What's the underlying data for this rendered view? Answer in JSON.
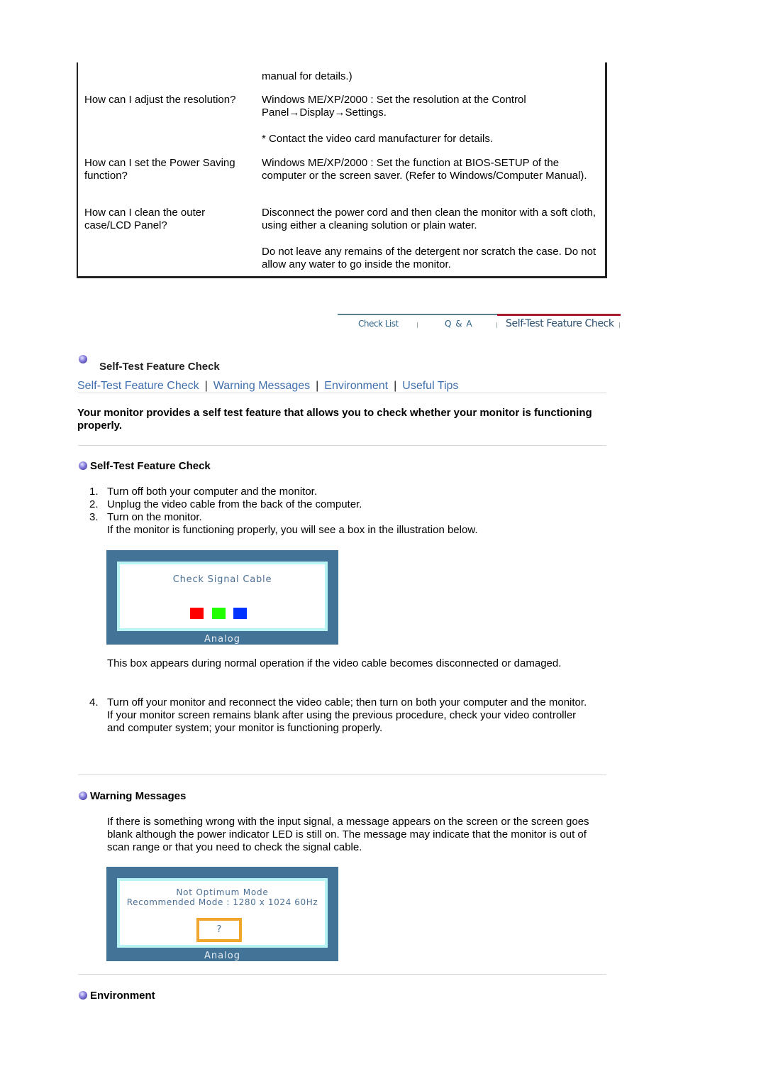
{
  "faq": {
    "rows": [
      {
        "question": "",
        "answers": [
          "manual for details.)"
        ]
      },
      {
        "question": "How can I adjust the resolution?",
        "answers": [
          "Windows ME/XP/2000 : Set the resolution at the Control Panel→Display→Settings.",
          "* Contact the video card manufacturer for details."
        ]
      },
      {
        "question": "How can I set the Power Saving function?",
        "answers": [
          "Windows ME/XP/2000 : Set the function at BIOS-SETUP of the computer or the screen saver. (Refer to Windows/Computer Manual)."
        ]
      },
      {
        "question": "How can I clean the outer case/LCD Panel?",
        "answers": [
          "Disconnect the power cord and then clean the monitor with a soft cloth, using either a cleaning solution or plain water.",
          "Do not leave any remains of the detergent nor scratch the case. Do not allow any water to go inside the monitor."
        ]
      }
    ]
  },
  "nav": {
    "tabs": [
      {
        "label": "Check List",
        "active": false
      },
      {
        "label": "Q & A",
        "active": false
      },
      {
        "label": "Self-Test Feature Check",
        "active": true
      }
    ],
    "active_color": "#a51d2d"
  },
  "page": {
    "title": "Self-Test Feature Check",
    "sub_links": [
      "Self-Test Feature Check",
      "Warning Messages",
      "Environment",
      "Useful Tips"
    ],
    "link_color": "#3f6fae",
    "intro": "Your monitor provides a self test feature that allows you to check whether your monitor is functioning properly."
  },
  "self_test": {
    "heading": "Self-Test Feature Check",
    "steps": [
      {
        "num": "1.",
        "text": "Turn off both your computer and the monitor."
      },
      {
        "num": "2.",
        "text": "Unplug the video cable from the back of the computer."
      },
      {
        "num": "3.",
        "text": "Turn on the monitor.",
        "extra": "If the monitor is functioning properly, you will see a box in the illustration below."
      }
    ],
    "osd": {
      "message": "Check Signal Cable",
      "footer": "Analog",
      "squares": [
        "#ff0000",
        "#22ff00",
        "#0033ff"
      ]
    },
    "after_box": "This box appears during normal operation if the video cable becomes disconnected or damaged.",
    "step4": {
      "num": "4.",
      "text": "Turn off your monitor and reconnect the video cable; then turn on both your computer and the monitor.",
      "extra": "If your monitor screen remains blank after using the previous procedure, check your video controller and computer system; your monitor is functioning properly."
    }
  },
  "warning": {
    "heading": "Warning Messages",
    "text": "If there is something wrong with the input signal, a message appears on the screen or the screen goes blank although the power indicator LED is still on. The message may indicate that the monitor is out of scan range or that you need to check the signal cable.",
    "osd": {
      "line1": "Not Optimum Mode",
      "line2": "Recommended Mode : 1280 x 1024  60Hz",
      "button": "?",
      "footer": "Analog"
    }
  },
  "environment": {
    "heading": "Environment"
  }
}
